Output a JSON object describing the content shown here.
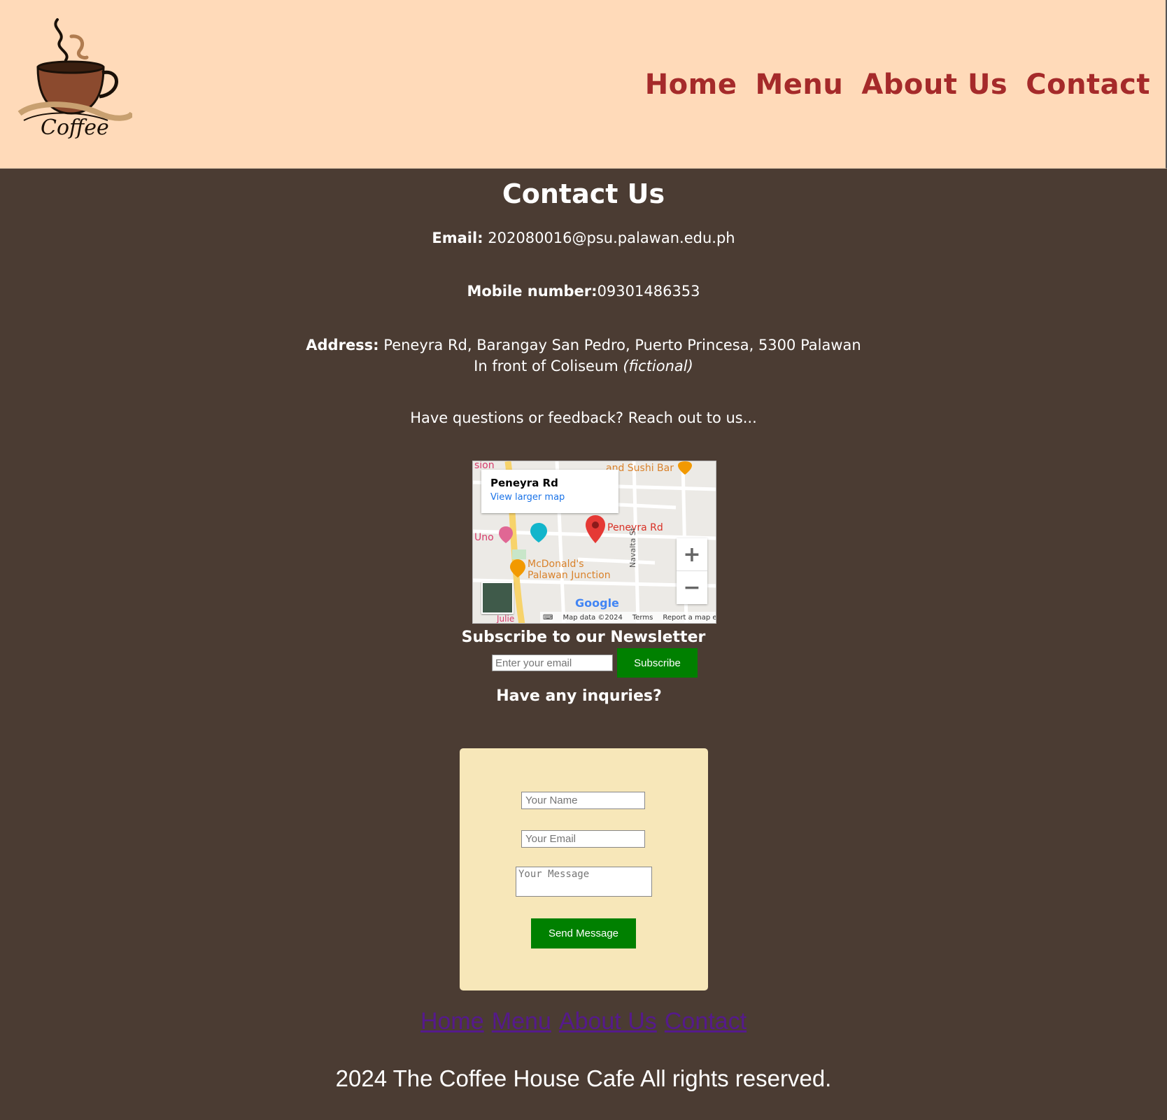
{
  "header": {
    "logo_text": "Coffee",
    "nav": [
      "Home",
      "Menu",
      "About Us",
      "Contact"
    ]
  },
  "contact": {
    "title": "Contact Us",
    "email_label": "Email:",
    "email_value": "202080016@psu.palawan.edu.ph",
    "mobile_label": "Mobile number:",
    "mobile_value": "09301486353",
    "address_label": "Address:",
    "address_value": "Peneyra Rd, Barangay San Pedro, Puerto Princesa, 5300 Palawan",
    "address_line2": "In front of Coliseum",
    "address_note": "(fictional)",
    "cta": "Have questions or feedback? Reach out to us..."
  },
  "map": {
    "place_title": "Peneyra Rd",
    "larger_map_link": "View larger map",
    "pin_label": "Peneyra Rd",
    "poi": [
      "McDonald's",
      "Palawan Junction",
      "Uno",
      "sion",
      "and Sushi Bar",
      "Navalta St",
      "Julie"
    ],
    "google": "Google",
    "footer": [
      "Map data ©2024",
      "Terms",
      "Report a map error"
    ],
    "zoom_in": "+",
    "zoom_out": "−"
  },
  "newsletter": {
    "title": "Subscribe to our Newsletter",
    "placeholder": "Enter your email",
    "button": "Subscribe"
  },
  "inquiry": {
    "title": "Have any inquries?",
    "name_placeholder": "Your Name",
    "email_placeholder": "Your Email",
    "message_placeholder": "Your Message",
    "send_button": "Send Message"
  },
  "footer": {
    "nav": [
      "Home",
      "Menu",
      "About Us",
      "Contact"
    ],
    "copyright": "2024 The Coffee House Cafe All rights reserved."
  },
  "colors": {
    "header_bg": "#ffdab9",
    "page_bg": "#4b3c33",
    "nav_link": "#a52a2a",
    "button_green": "#008000",
    "form_bg": "#f7e7b9",
    "footer_link": "#551a8b"
  }
}
